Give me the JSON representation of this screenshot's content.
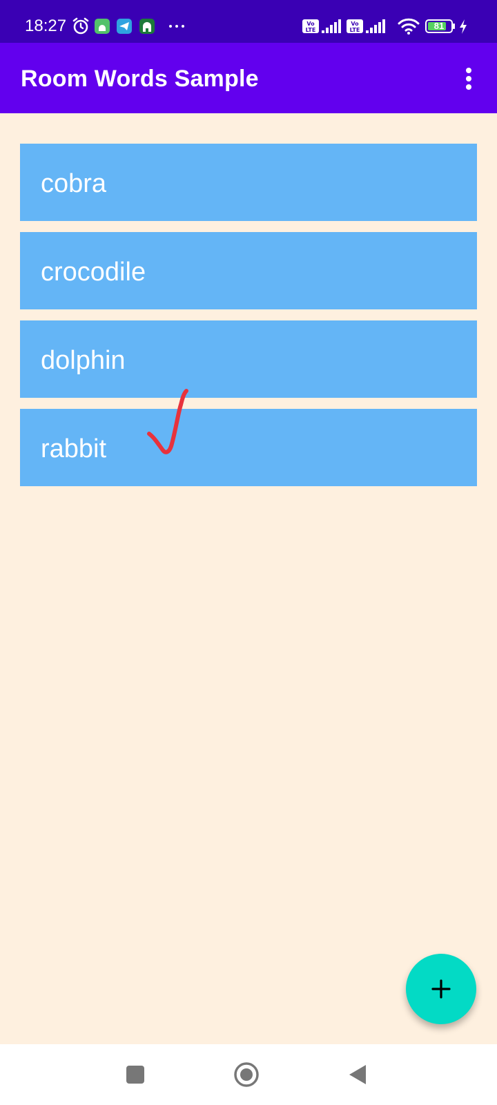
{
  "status_bar": {
    "time": "18:27",
    "battery": "81",
    "icons": [
      "alarm-icon",
      "android-app-icon",
      "telegram-icon",
      "mosque-app-icon",
      "more-notifications-icon",
      "volte-icon",
      "signal-icon",
      "volte-icon",
      "signal-icon",
      "wifi-icon",
      "battery-icon",
      "charging-icon"
    ]
  },
  "app_bar": {
    "title": "Room Words Sample",
    "menu_icon": "more-vert-icon"
  },
  "words": [
    "cobra",
    "crocodile",
    "dolphin",
    "rabbit"
  ],
  "fab": {
    "icon": "add-icon"
  },
  "nav_bar": {
    "icons": [
      "recents-icon",
      "home-icon",
      "back-icon"
    ]
  },
  "colors": {
    "status_bar": "#3a00b4",
    "app_bar": "#6200ee",
    "background": "#fef0df",
    "list_item": "#64b5f6",
    "fab": "#03dac5",
    "checkmark": "#e8323c"
  }
}
